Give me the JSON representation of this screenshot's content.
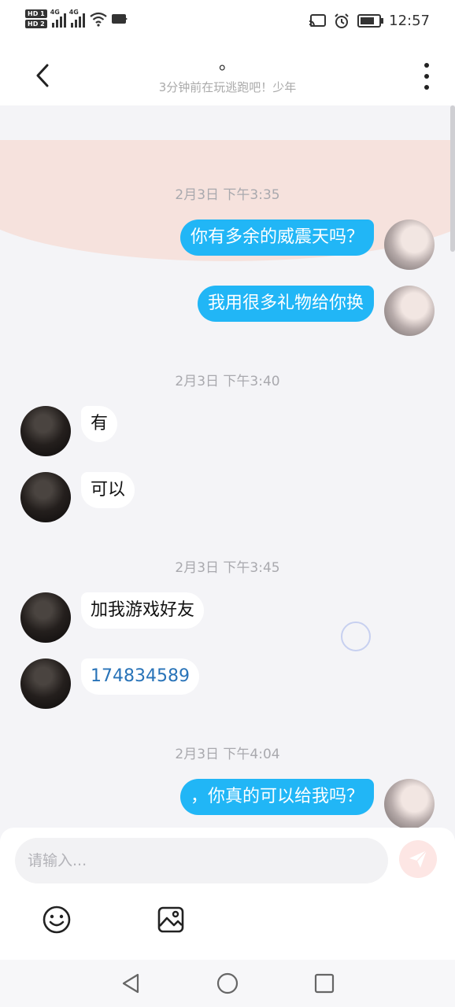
{
  "status_bar": {
    "time": "12:57",
    "sim1": "HD 1",
    "sim2": "HD 2",
    "network1": "4G",
    "network2": "4G"
  },
  "header": {
    "title": "。",
    "subtitle": "3分钟前在玩逃跑吧！少年"
  },
  "messages": [
    {
      "type": "time",
      "text": "2月3日 下午3:35"
    },
    {
      "type": "msg",
      "side": "right",
      "text": "你有多余的威震天吗？"
    },
    {
      "type": "msg",
      "side": "right",
      "text": "我用很多礼物给你换"
    },
    {
      "type": "time",
      "text": "2月3日 下午3:40"
    },
    {
      "type": "msg",
      "side": "left",
      "text": "有"
    },
    {
      "type": "msg",
      "side": "left",
      "text": "可以"
    },
    {
      "type": "time",
      "text": "2月3日 下午3:45"
    },
    {
      "type": "msg",
      "side": "left",
      "text": "加我游戏好友"
    },
    {
      "type": "msg",
      "side": "left",
      "text": "174834589",
      "link": true
    },
    {
      "type": "time",
      "text": "2月3日 下午4:04"
    },
    {
      "type": "msg",
      "side": "right",
      "text": "，你真的可以给我吗？"
    }
  ],
  "input": {
    "placeholder": "请输入..."
  },
  "icons": {
    "back": "back-arrow-icon",
    "more": "more-vertical-icon",
    "send": "send-icon",
    "emoji": "emoji-icon",
    "image": "image-icon"
  },
  "colors": {
    "bubble_right": "#21b6f6",
    "bubble_left": "#ffffff",
    "link": "#2873b8",
    "background": "#f4f4f7"
  }
}
